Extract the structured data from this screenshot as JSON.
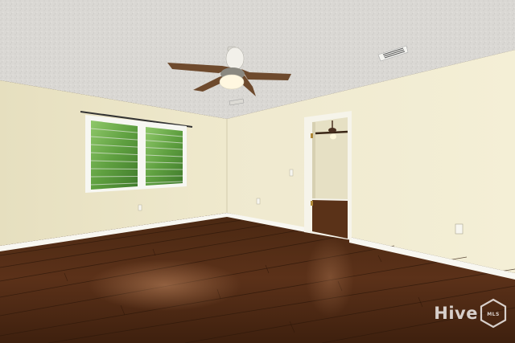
{
  "watermark": {
    "brand_text": "Hive",
    "badge_text": "MLS"
  },
  "colors": {
    "ceiling": "#dcdad6",
    "wall_left": "#ece6c8",
    "wall_right": "#f3eed5",
    "baseboard": "#f7f6f0",
    "floor_dark": "#3a1f10",
    "floor_mid": "#5a311a",
    "floor_light": "#7a4a2a"
  }
}
